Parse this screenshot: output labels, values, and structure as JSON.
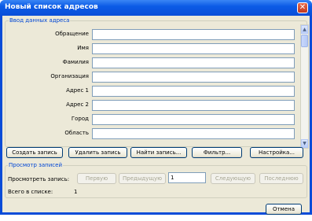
{
  "window": {
    "title": "Новый список адресов",
    "close_icon": "close-icon"
  },
  "entry_group": {
    "legend": "Ввод данных адреса",
    "fields": [
      {
        "label": "Обращение",
        "value": ""
      },
      {
        "label": "Имя",
        "value": ""
      },
      {
        "label": "Фамилия",
        "value": ""
      },
      {
        "label": "Организация",
        "value": ""
      },
      {
        "label": "Адрес 1",
        "value": ""
      },
      {
        "label": "Адрес 2",
        "value": ""
      },
      {
        "label": "Город",
        "value": ""
      },
      {
        "label": "Область",
        "value": ""
      }
    ]
  },
  "buttons": {
    "create": "Создать запись",
    "delete": "Удалить запись",
    "find": "Найти запись...",
    "filter": "Фильтр...",
    "settings": "Настройка..."
  },
  "view_group": {
    "legend": "Просмотр записей",
    "view_label": "Просмотреть запись:",
    "first": "Первую",
    "prev": "Предыдущую",
    "record_number": "1",
    "next": "Следующую",
    "last": "Последнюю",
    "total_label": "Всего в списке:",
    "total_value": "1"
  },
  "cancel": "Отмена"
}
